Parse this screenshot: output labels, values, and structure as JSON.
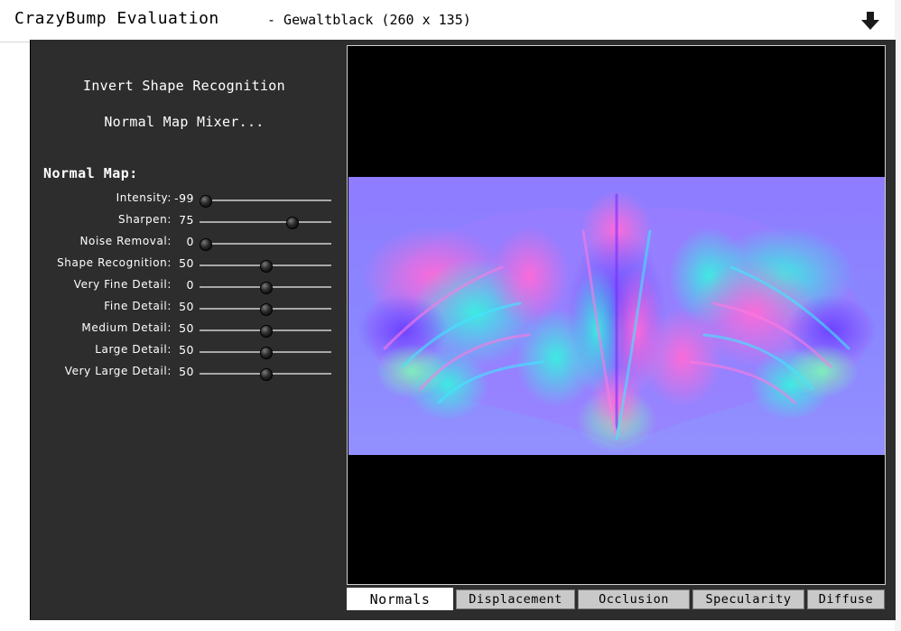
{
  "window": {
    "app_title": "CrazyBump Evaluation",
    "doc_title": "- Gewaltblack (260 x 135)"
  },
  "panel": {
    "invert_button": "Invert Shape Recognition",
    "mixer_button": "Normal Map Mixer...",
    "section_title": "Normal Map:",
    "sliders": [
      {
        "label": "Intensity:",
        "value": "-99",
        "level": 0.0
      },
      {
        "label": "Sharpen:",
        "value": "75",
        "level": 0.72
      },
      {
        "label": "Noise Removal:",
        "value": "0",
        "level": 0.0
      },
      {
        "label": "Shape Recognition:",
        "value": "50",
        "level": 0.5
      },
      {
        "label": "Very Fine Detail:",
        "value": "0",
        "level": 0.5
      },
      {
        "label": "Fine Detail:",
        "value": "50",
        "level": 0.5
      },
      {
        "label": "Medium Detail:",
        "value": "50",
        "level": 0.5
      },
      {
        "label": "Large Detail:",
        "value": "50",
        "level": 0.5
      },
      {
        "label": "Very Large Detail:",
        "value": "50",
        "level": 0.5
      }
    ]
  },
  "tabs": [
    {
      "label": "Normals",
      "active": true
    },
    {
      "label": "Displacement",
      "active": false
    },
    {
      "label": "Occlusion",
      "active": false
    },
    {
      "label": "Specularity",
      "active": false
    },
    {
      "label": "Diffuse",
      "active": false
    }
  ],
  "icons": {
    "download": "download-arrow-icon"
  },
  "colors": {
    "panel_bg": "#2d2d2d",
    "normal_base": "#8080ff"
  }
}
